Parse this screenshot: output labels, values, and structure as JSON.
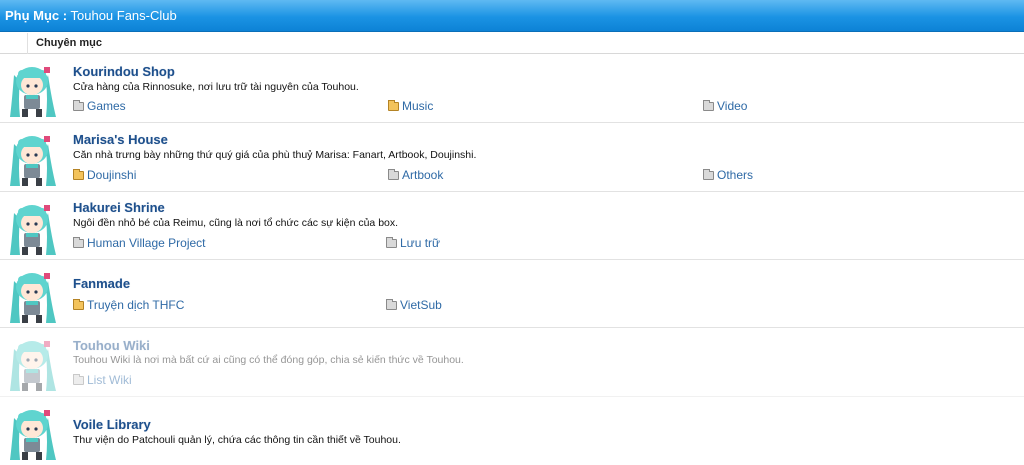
{
  "header": {
    "prefix": "Phụ Mục :",
    "title": "Touhou Fans-Club"
  },
  "column_header": "Chuyên mục",
  "colors": {
    "header_bar": "#1b93e4",
    "title_link": "#1d4f8c",
    "sub_link": "#2f6aa6",
    "folder_new": "#f3c35c",
    "folder_read": "#d9d9d9"
  },
  "forums": [
    {
      "title": "Kourindou Shop",
      "description": "Cửa hàng của Rinnosuke, nơi lưu trữ tài nguyên của Touhou.",
      "subforums": [
        {
          "label": "Games",
          "icon": "folder-icon"
        },
        {
          "label": "Music",
          "icon": "folder-new-icon"
        },
        {
          "label": "Video",
          "icon": "folder-icon"
        }
      ]
    },
    {
      "title": "Marisa's House",
      "description": "Căn nhà trưng bày những thứ quý giá của phù thuỷ Marisa: Fanart, Artbook, Doujinshi.",
      "subforums": [
        {
          "label": "Doujinshi",
          "icon": "folder-new-icon"
        },
        {
          "label": "Artbook",
          "icon": "folder-icon"
        },
        {
          "label": "Others",
          "icon": "folder-icon"
        }
      ]
    },
    {
      "title": "Hakurei Shrine",
      "description": "Ngôi đền nhỏ bé của Reimu, cũng là nơi tổ chức các sự kiện của box.",
      "subforums": [
        {
          "label": "Human Village Project",
          "icon": "folder-icon"
        },
        {
          "label": "Lưu trữ",
          "icon": "folder-icon"
        }
      ]
    },
    {
      "title": "Fanmade",
      "description": "",
      "subforums": [
        {
          "label": "Truyện dịch THFC",
          "icon": "folder-new-icon"
        },
        {
          "label": "VietSub",
          "icon": "folder-icon"
        }
      ]
    },
    {
      "title": "Touhou Wiki",
      "description": "Touhou Wiki là nơi mà bất cứ ai cũng có thể đóng góp, chia sẻ kiến thức về Touhou.",
      "subforums": [
        {
          "label": "List Wiki",
          "icon": "folder-icon"
        }
      ]
    },
    {
      "title": "Voile Library",
      "description": "Thư viện do Patchouli quản lý, chứa các thông tin cần thiết về Touhou.",
      "subforums": []
    }
  ]
}
